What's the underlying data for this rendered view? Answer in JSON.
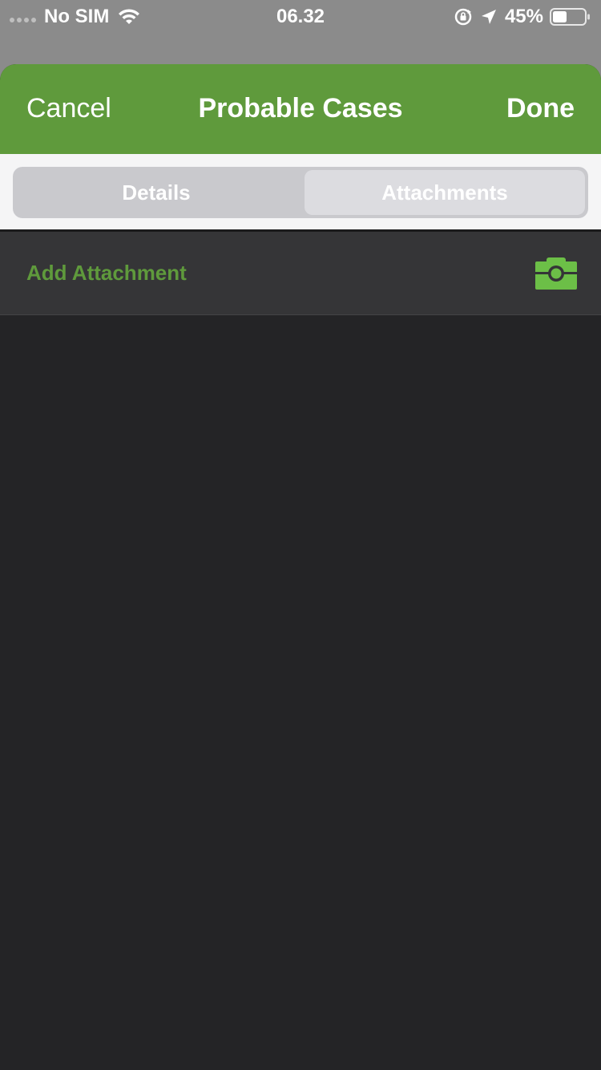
{
  "status_bar": {
    "carrier": "No SIM",
    "time": "06.32",
    "battery": "45%",
    "icons": [
      "signal-dots-icon",
      "wifi-icon",
      "rotation-lock-icon",
      "location-arrow-icon",
      "battery-icon"
    ]
  },
  "nav": {
    "cancel_label": "Cancel",
    "title": "Probable Cases",
    "done_label": "Done"
  },
  "segments": {
    "details_label": "Details",
    "attachments_label": "Attachments",
    "selected": "Attachments"
  },
  "attachments": {
    "add_label": "Add Attachment",
    "icon": "camera-icon"
  },
  "colors": {
    "accent": "#5f9a3c",
    "camera": "#6cbf47",
    "background": "#242426",
    "row": "#353537",
    "backdrop": "#8b8b8b"
  }
}
